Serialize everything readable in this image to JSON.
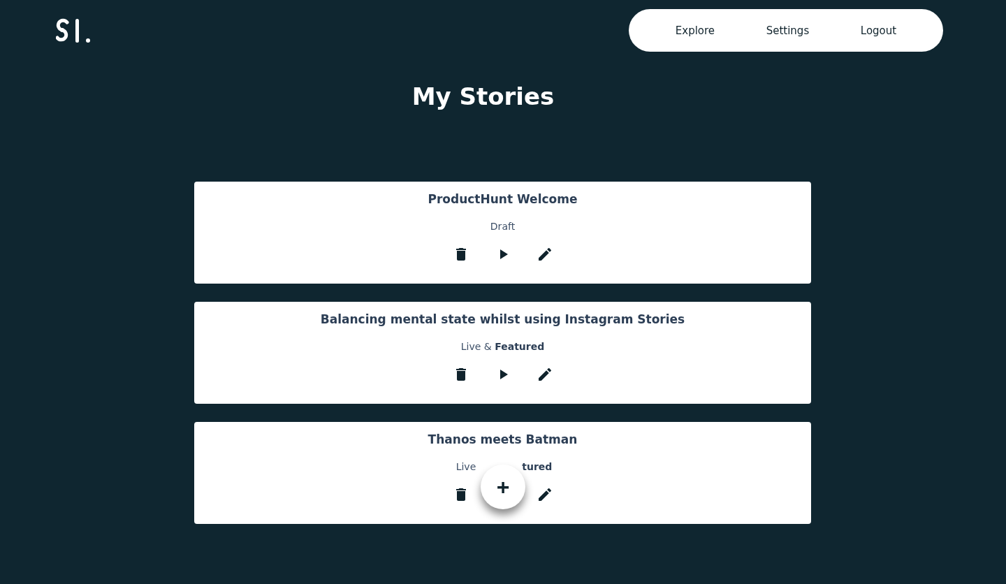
{
  "nav": [
    {
      "label": "Explore"
    },
    {
      "label": "Settings"
    },
    {
      "label": "Logout"
    }
  ],
  "title": "My Stories",
  "stories": [
    {
      "title": "ProductHunt Welcome",
      "status": "Draft",
      "actions": [
        {
          "kind": "delete"
        },
        {
          "kind": "play"
        },
        {
          "kind": "edit"
        }
      ]
    },
    {
      "title": "Balancing mental state whilst using Instagram Stories",
      "status": "Live & **Featured**",
      "actions": [
        {
          "kind": "delete"
        },
        {
          "kind": "play"
        },
        {
          "kind": "edit"
        }
      ]
    },
    {
      "title": "Thanos meets Batman",
      "status_parts": [
        "Live",
        "**tured**"
      ],
      "actions": [
        {
          "kind": "delete"
        },
        {
          "kind": "covered"
        },
        {
          "kind": "edit"
        }
      ]
    }
  ],
  "fab": {
    "label": "+"
  }
}
